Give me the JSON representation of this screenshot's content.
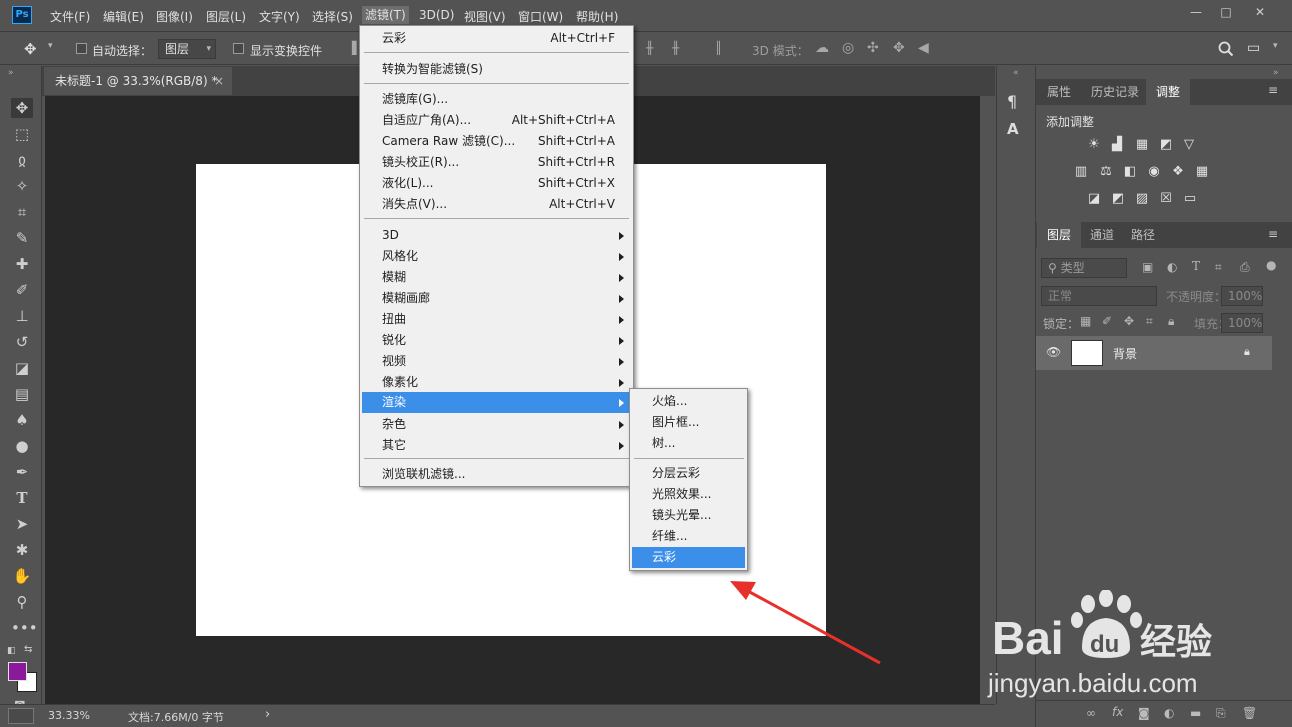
{
  "app": {
    "logo": "Ps"
  },
  "menubar": {
    "items": [
      "文件(F)",
      "编辑(E)",
      "图像(I)",
      "图层(L)",
      "文字(Y)",
      "选择(S)",
      "滤镜(T)",
      "3D(D)",
      "视图(V)",
      "窗口(W)",
      "帮助(H)"
    ],
    "active": "滤镜(T)"
  },
  "window_controls": {
    "minimize": "—",
    "maximize": "□",
    "close": "✕"
  },
  "options_bar": {
    "auto_select_label": "自动选择：",
    "auto_select_target": "图层",
    "show_transform_label": "显示变换控件",
    "mode_3d_label": "3D 模式："
  },
  "document_tab": {
    "title": "未标题-1 @ 33.3%(RGB/8) *",
    "close": "×"
  },
  "status_bar": {
    "zoom": "33.33%",
    "doc_info": "文档:7.66M/0 字节",
    "arrow": "›"
  },
  "filter_menu": {
    "items": [
      {
        "label": "云彩",
        "shortcut": "Alt+Ctrl+F"
      },
      {
        "label": "转换为智能滤镜(S)",
        "shortcut": ""
      },
      {
        "label": "滤镜库(G)...",
        "shortcut": ""
      },
      {
        "label": "自适应广角(A)...",
        "shortcut": "Alt+Shift+Ctrl+A"
      },
      {
        "label": "Camera Raw 滤镜(C)...",
        "shortcut": "Shift+Ctrl+A"
      },
      {
        "label": "镜头校正(R)...",
        "shortcut": "Shift+Ctrl+R"
      },
      {
        "label": "液化(L)...",
        "shortcut": "Shift+Ctrl+X"
      },
      {
        "label": "消失点(V)...",
        "shortcut": "Alt+Ctrl+V"
      },
      {
        "label": "3D",
        "submenu": true
      },
      {
        "label": "风格化",
        "submenu": true
      },
      {
        "label": "模糊",
        "submenu": true
      },
      {
        "label": "模糊画廊",
        "submenu": true
      },
      {
        "label": "扭曲",
        "submenu": true
      },
      {
        "label": "锐化",
        "submenu": true
      },
      {
        "label": "视频",
        "submenu": true
      },
      {
        "label": "像素化",
        "submenu": true
      },
      {
        "label": "渲染",
        "submenu": true,
        "highlighted": true
      },
      {
        "label": "杂色",
        "submenu": true
      },
      {
        "label": "其它",
        "submenu": true
      },
      {
        "label": "浏览联机滤镜...",
        "shortcut": ""
      }
    ]
  },
  "render_submenu": {
    "items": [
      {
        "label": "火焰..."
      },
      {
        "label": "图片框..."
      },
      {
        "label": "树..."
      },
      {
        "label": "分层云彩"
      },
      {
        "label": "光照效果..."
      },
      {
        "label": "镜头光晕..."
      },
      {
        "label": "纤维..."
      },
      {
        "label": "云彩",
        "highlighted": true
      }
    ]
  },
  "adjustments_panel": {
    "tabs": [
      "属性",
      "历史记录",
      "调整"
    ],
    "active_tab": "调整",
    "add_adjustment_label": "添加调整"
  },
  "layers_panel": {
    "tabs": [
      "图层",
      "通道",
      "路径"
    ],
    "active_tab": "图层",
    "filter_kind": "类型",
    "blend_mode": "正常",
    "opacity_label": "不透明度：",
    "opacity_value": "100%",
    "lock_label": "锁定：",
    "fill_label": "填充：",
    "fill_value": "100%",
    "layers": [
      {
        "name": "背景",
        "visible": true,
        "locked": true
      }
    ]
  },
  "colors": {
    "foreground": "#8b1a9a",
    "background": "#ffffff",
    "menu_highlight": "#3c8fe8",
    "annotation_arrow": "#e8302a"
  },
  "watermark": {
    "brand": "Baidu经验",
    "url": "jingyan.baidu.com"
  }
}
